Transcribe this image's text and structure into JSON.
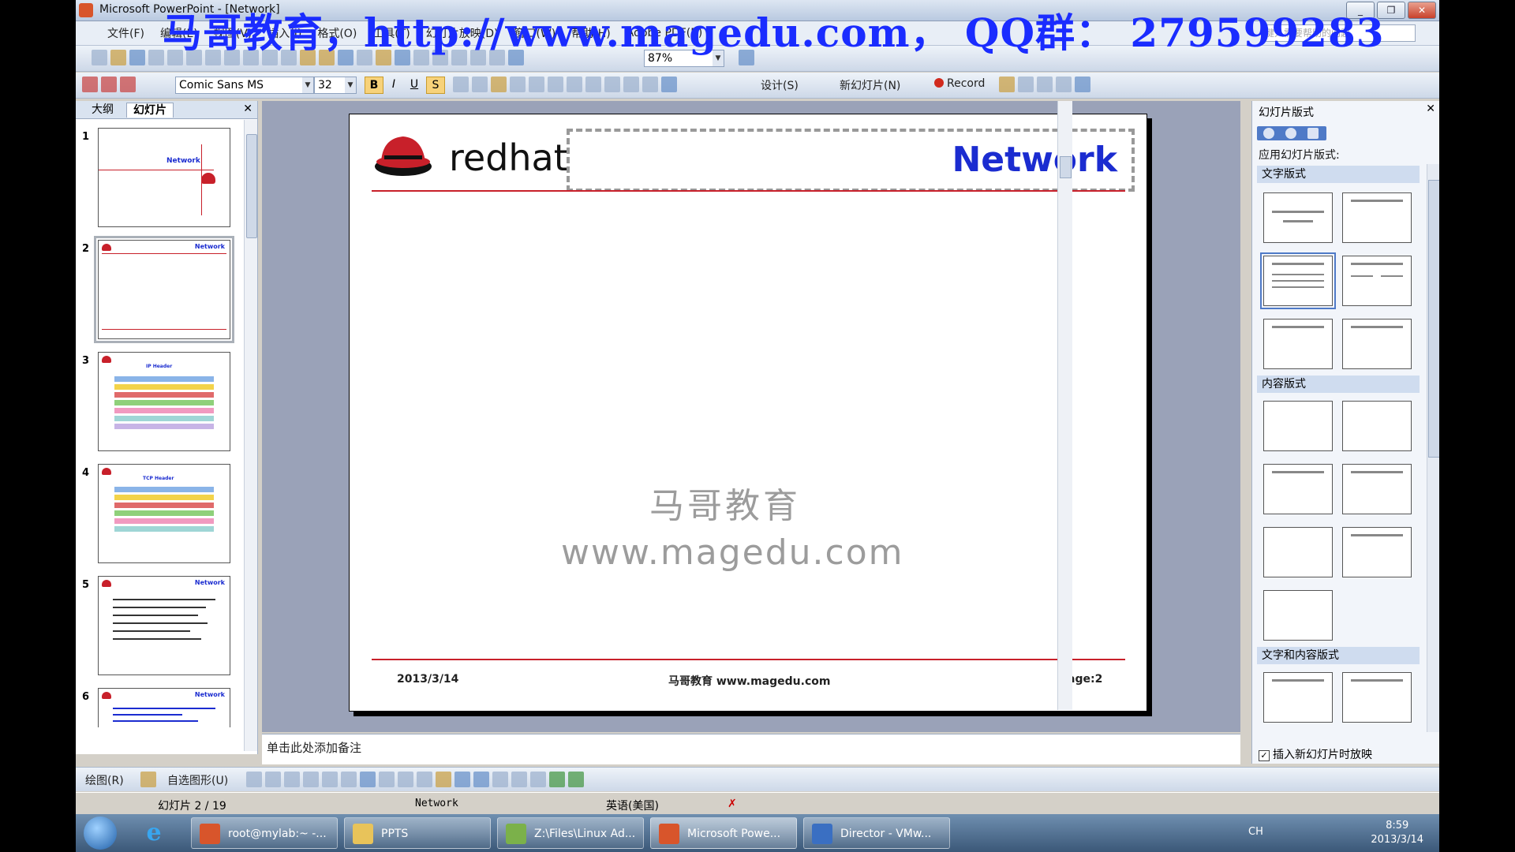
{
  "window": {
    "title": "Microsoft PowerPoint - [Network]",
    "banner": "马哥教育，http://www.magedu.com， QQ群： 279599283",
    "controls": [
      "_",
      "❐",
      "✕"
    ]
  },
  "menu": {
    "items": [
      "文件(F)",
      "编辑(E)",
      "视图(V)",
      "插入(I)",
      "格式(O)",
      "工具(T)",
      "幻灯片放映(D)",
      "窗口(W)",
      "帮助(H)",
      "Adobe PDF(B)"
    ],
    "help_placeholder": "键入需要帮助的问题"
  },
  "standard_toolbar": {
    "zoom": "87%"
  },
  "format_toolbar": {
    "font": "Comic Sans MS",
    "size": "32",
    "bold": "B",
    "italic": "I",
    "underline": "U",
    "shadow": "S",
    "design_label": "设计(S)",
    "new_slide_label": "新幻灯片(N)",
    "record_label": "Record"
  },
  "left_pane": {
    "tabs": [
      "大纲",
      "幻灯片"
    ],
    "thumbs": [
      {
        "num": "1",
        "title": "Network"
      },
      {
        "num": "2",
        "title": "Network"
      },
      {
        "num": "3",
        "title": "IP Header"
      },
      {
        "num": "4",
        "title": "TCP Header"
      },
      {
        "num": "5",
        "title": "Network"
      },
      {
        "num": "6",
        "title": "Network"
      }
    ]
  },
  "slide": {
    "brand": "redhat",
    "title": "Network",
    "watermark_cn": "马哥教育",
    "watermark_url": "www.magedu.com",
    "footer_date": "2013/3/14",
    "footer_center": "马哥教育 www.magedu.com",
    "footer_page": "page:2"
  },
  "notes": {
    "placeholder": "单击此处添加备注"
  },
  "task_pane": {
    "title": "幻灯片版式",
    "apply_label": "应用幻灯片版式:",
    "section_text": "文字版式",
    "section_content": "内容版式",
    "section_text_content": "文字和内容版式",
    "checkbox": "插入新幻灯片时放映"
  },
  "drawing_toolbar": {
    "draw_label": "绘图(R)",
    "autoshape_label": "自选图形(U)"
  },
  "status": {
    "slide": "幻灯片 2 / 19",
    "design": "Network",
    "language": "英语(美国)"
  },
  "taskbar": {
    "buttons": [
      "root@mylab:~ -...",
      "PPTS",
      "Z:\\Files\\Linux Ad...",
      "Microsoft Powe...",
      "Director - VMw..."
    ],
    "lang": "CH",
    "time": "8:59",
    "date": "2013/3/14"
  },
  "colors": {
    "title_blue": "#1b2cd0",
    "redhat_red": "#c8202a",
    "banner_blue": "#1a2cff"
  }
}
